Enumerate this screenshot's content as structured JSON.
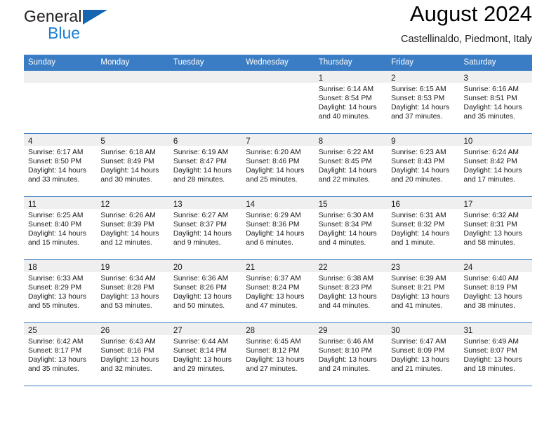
{
  "brand": {
    "line1": "General",
    "line2": "Blue",
    "flag_color": "#1565b0",
    "blue_text_color": "#1b7fd4"
  },
  "header": {
    "title": "August 2024",
    "location": "Castellinaldo, Piedmont, Italy"
  },
  "theme": {
    "header_blue": "#3b7dc4",
    "daynum_band": "#efefef",
    "text": "#1a1a1a"
  },
  "weekday_headers": [
    "Sunday",
    "Monday",
    "Tuesday",
    "Wednesday",
    "Thursday",
    "Friday",
    "Saturday"
  ],
  "labels": {
    "sunrise_prefix": "Sunrise:",
    "sunset_prefix": "Sunset:",
    "daylight_prefix": "Daylight:"
  },
  "weeks": [
    [
      {
        "day": "",
        "sunrise": "",
        "sunset": "",
        "daylight_a": "",
        "daylight_b": ""
      },
      {
        "day": "",
        "sunrise": "",
        "sunset": "",
        "daylight_a": "",
        "daylight_b": ""
      },
      {
        "day": "",
        "sunrise": "",
        "sunset": "",
        "daylight_a": "",
        "daylight_b": ""
      },
      {
        "day": "",
        "sunrise": "",
        "sunset": "",
        "daylight_a": "",
        "daylight_b": ""
      },
      {
        "day": "1",
        "sunrise": "Sunrise: 6:14 AM",
        "sunset": "Sunset: 8:54 PM",
        "daylight_a": "Daylight: 14 hours",
        "daylight_b": "and 40 minutes."
      },
      {
        "day": "2",
        "sunrise": "Sunrise: 6:15 AM",
        "sunset": "Sunset: 8:53 PM",
        "daylight_a": "Daylight: 14 hours",
        "daylight_b": "and 37 minutes."
      },
      {
        "day": "3",
        "sunrise": "Sunrise: 6:16 AM",
        "sunset": "Sunset: 8:51 PM",
        "daylight_a": "Daylight: 14 hours",
        "daylight_b": "and 35 minutes."
      }
    ],
    [
      {
        "day": "4",
        "sunrise": "Sunrise: 6:17 AM",
        "sunset": "Sunset: 8:50 PM",
        "daylight_a": "Daylight: 14 hours",
        "daylight_b": "and 33 minutes."
      },
      {
        "day": "5",
        "sunrise": "Sunrise: 6:18 AM",
        "sunset": "Sunset: 8:49 PM",
        "daylight_a": "Daylight: 14 hours",
        "daylight_b": "and 30 minutes."
      },
      {
        "day": "6",
        "sunrise": "Sunrise: 6:19 AM",
        "sunset": "Sunset: 8:47 PM",
        "daylight_a": "Daylight: 14 hours",
        "daylight_b": "and 28 minutes."
      },
      {
        "day": "7",
        "sunrise": "Sunrise: 6:20 AM",
        "sunset": "Sunset: 8:46 PM",
        "daylight_a": "Daylight: 14 hours",
        "daylight_b": "and 25 minutes."
      },
      {
        "day": "8",
        "sunrise": "Sunrise: 6:22 AM",
        "sunset": "Sunset: 8:45 PM",
        "daylight_a": "Daylight: 14 hours",
        "daylight_b": "and 22 minutes."
      },
      {
        "day": "9",
        "sunrise": "Sunrise: 6:23 AM",
        "sunset": "Sunset: 8:43 PM",
        "daylight_a": "Daylight: 14 hours",
        "daylight_b": "and 20 minutes."
      },
      {
        "day": "10",
        "sunrise": "Sunrise: 6:24 AM",
        "sunset": "Sunset: 8:42 PM",
        "daylight_a": "Daylight: 14 hours",
        "daylight_b": "and 17 minutes."
      }
    ],
    [
      {
        "day": "11",
        "sunrise": "Sunrise: 6:25 AM",
        "sunset": "Sunset: 8:40 PM",
        "daylight_a": "Daylight: 14 hours",
        "daylight_b": "and 15 minutes."
      },
      {
        "day": "12",
        "sunrise": "Sunrise: 6:26 AM",
        "sunset": "Sunset: 8:39 PM",
        "daylight_a": "Daylight: 14 hours",
        "daylight_b": "and 12 minutes."
      },
      {
        "day": "13",
        "sunrise": "Sunrise: 6:27 AM",
        "sunset": "Sunset: 8:37 PM",
        "daylight_a": "Daylight: 14 hours",
        "daylight_b": "and 9 minutes."
      },
      {
        "day": "14",
        "sunrise": "Sunrise: 6:29 AM",
        "sunset": "Sunset: 8:36 PM",
        "daylight_a": "Daylight: 14 hours",
        "daylight_b": "and 6 minutes."
      },
      {
        "day": "15",
        "sunrise": "Sunrise: 6:30 AM",
        "sunset": "Sunset: 8:34 PM",
        "daylight_a": "Daylight: 14 hours",
        "daylight_b": "and 4 minutes."
      },
      {
        "day": "16",
        "sunrise": "Sunrise: 6:31 AM",
        "sunset": "Sunset: 8:32 PM",
        "daylight_a": "Daylight: 14 hours",
        "daylight_b": "and 1 minute."
      },
      {
        "day": "17",
        "sunrise": "Sunrise: 6:32 AM",
        "sunset": "Sunset: 8:31 PM",
        "daylight_a": "Daylight: 13 hours",
        "daylight_b": "and 58 minutes."
      }
    ],
    [
      {
        "day": "18",
        "sunrise": "Sunrise: 6:33 AM",
        "sunset": "Sunset: 8:29 PM",
        "daylight_a": "Daylight: 13 hours",
        "daylight_b": "and 55 minutes."
      },
      {
        "day": "19",
        "sunrise": "Sunrise: 6:34 AM",
        "sunset": "Sunset: 8:28 PM",
        "daylight_a": "Daylight: 13 hours",
        "daylight_b": "and 53 minutes."
      },
      {
        "day": "20",
        "sunrise": "Sunrise: 6:36 AM",
        "sunset": "Sunset: 8:26 PM",
        "daylight_a": "Daylight: 13 hours",
        "daylight_b": "and 50 minutes."
      },
      {
        "day": "21",
        "sunrise": "Sunrise: 6:37 AM",
        "sunset": "Sunset: 8:24 PM",
        "daylight_a": "Daylight: 13 hours",
        "daylight_b": "and 47 minutes."
      },
      {
        "day": "22",
        "sunrise": "Sunrise: 6:38 AM",
        "sunset": "Sunset: 8:23 PM",
        "daylight_a": "Daylight: 13 hours",
        "daylight_b": "and 44 minutes."
      },
      {
        "day": "23",
        "sunrise": "Sunrise: 6:39 AM",
        "sunset": "Sunset: 8:21 PM",
        "daylight_a": "Daylight: 13 hours",
        "daylight_b": "and 41 minutes."
      },
      {
        "day": "24",
        "sunrise": "Sunrise: 6:40 AM",
        "sunset": "Sunset: 8:19 PM",
        "daylight_a": "Daylight: 13 hours",
        "daylight_b": "and 38 minutes."
      }
    ],
    [
      {
        "day": "25",
        "sunrise": "Sunrise: 6:42 AM",
        "sunset": "Sunset: 8:17 PM",
        "daylight_a": "Daylight: 13 hours",
        "daylight_b": "and 35 minutes."
      },
      {
        "day": "26",
        "sunrise": "Sunrise: 6:43 AM",
        "sunset": "Sunset: 8:16 PM",
        "daylight_a": "Daylight: 13 hours",
        "daylight_b": "and 32 minutes."
      },
      {
        "day": "27",
        "sunrise": "Sunrise: 6:44 AM",
        "sunset": "Sunset: 8:14 PM",
        "daylight_a": "Daylight: 13 hours",
        "daylight_b": "and 29 minutes."
      },
      {
        "day": "28",
        "sunrise": "Sunrise: 6:45 AM",
        "sunset": "Sunset: 8:12 PM",
        "daylight_a": "Daylight: 13 hours",
        "daylight_b": "and 27 minutes."
      },
      {
        "day": "29",
        "sunrise": "Sunrise: 6:46 AM",
        "sunset": "Sunset: 8:10 PM",
        "daylight_a": "Daylight: 13 hours",
        "daylight_b": "and 24 minutes."
      },
      {
        "day": "30",
        "sunrise": "Sunrise: 6:47 AM",
        "sunset": "Sunset: 8:09 PM",
        "daylight_a": "Daylight: 13 hours",
        "daylight_b": "and 21 minutes."
      },
      {
        "day": "31",
        "sunrise": "Sunrise: 6:49 AM",
        "sunset": "Sunset: 8:07 PM",
        "daylight_a": "Daylight: 13 hours",
        "daylight_b": "and 18 minutes."
      }
    ]
  ]
}
